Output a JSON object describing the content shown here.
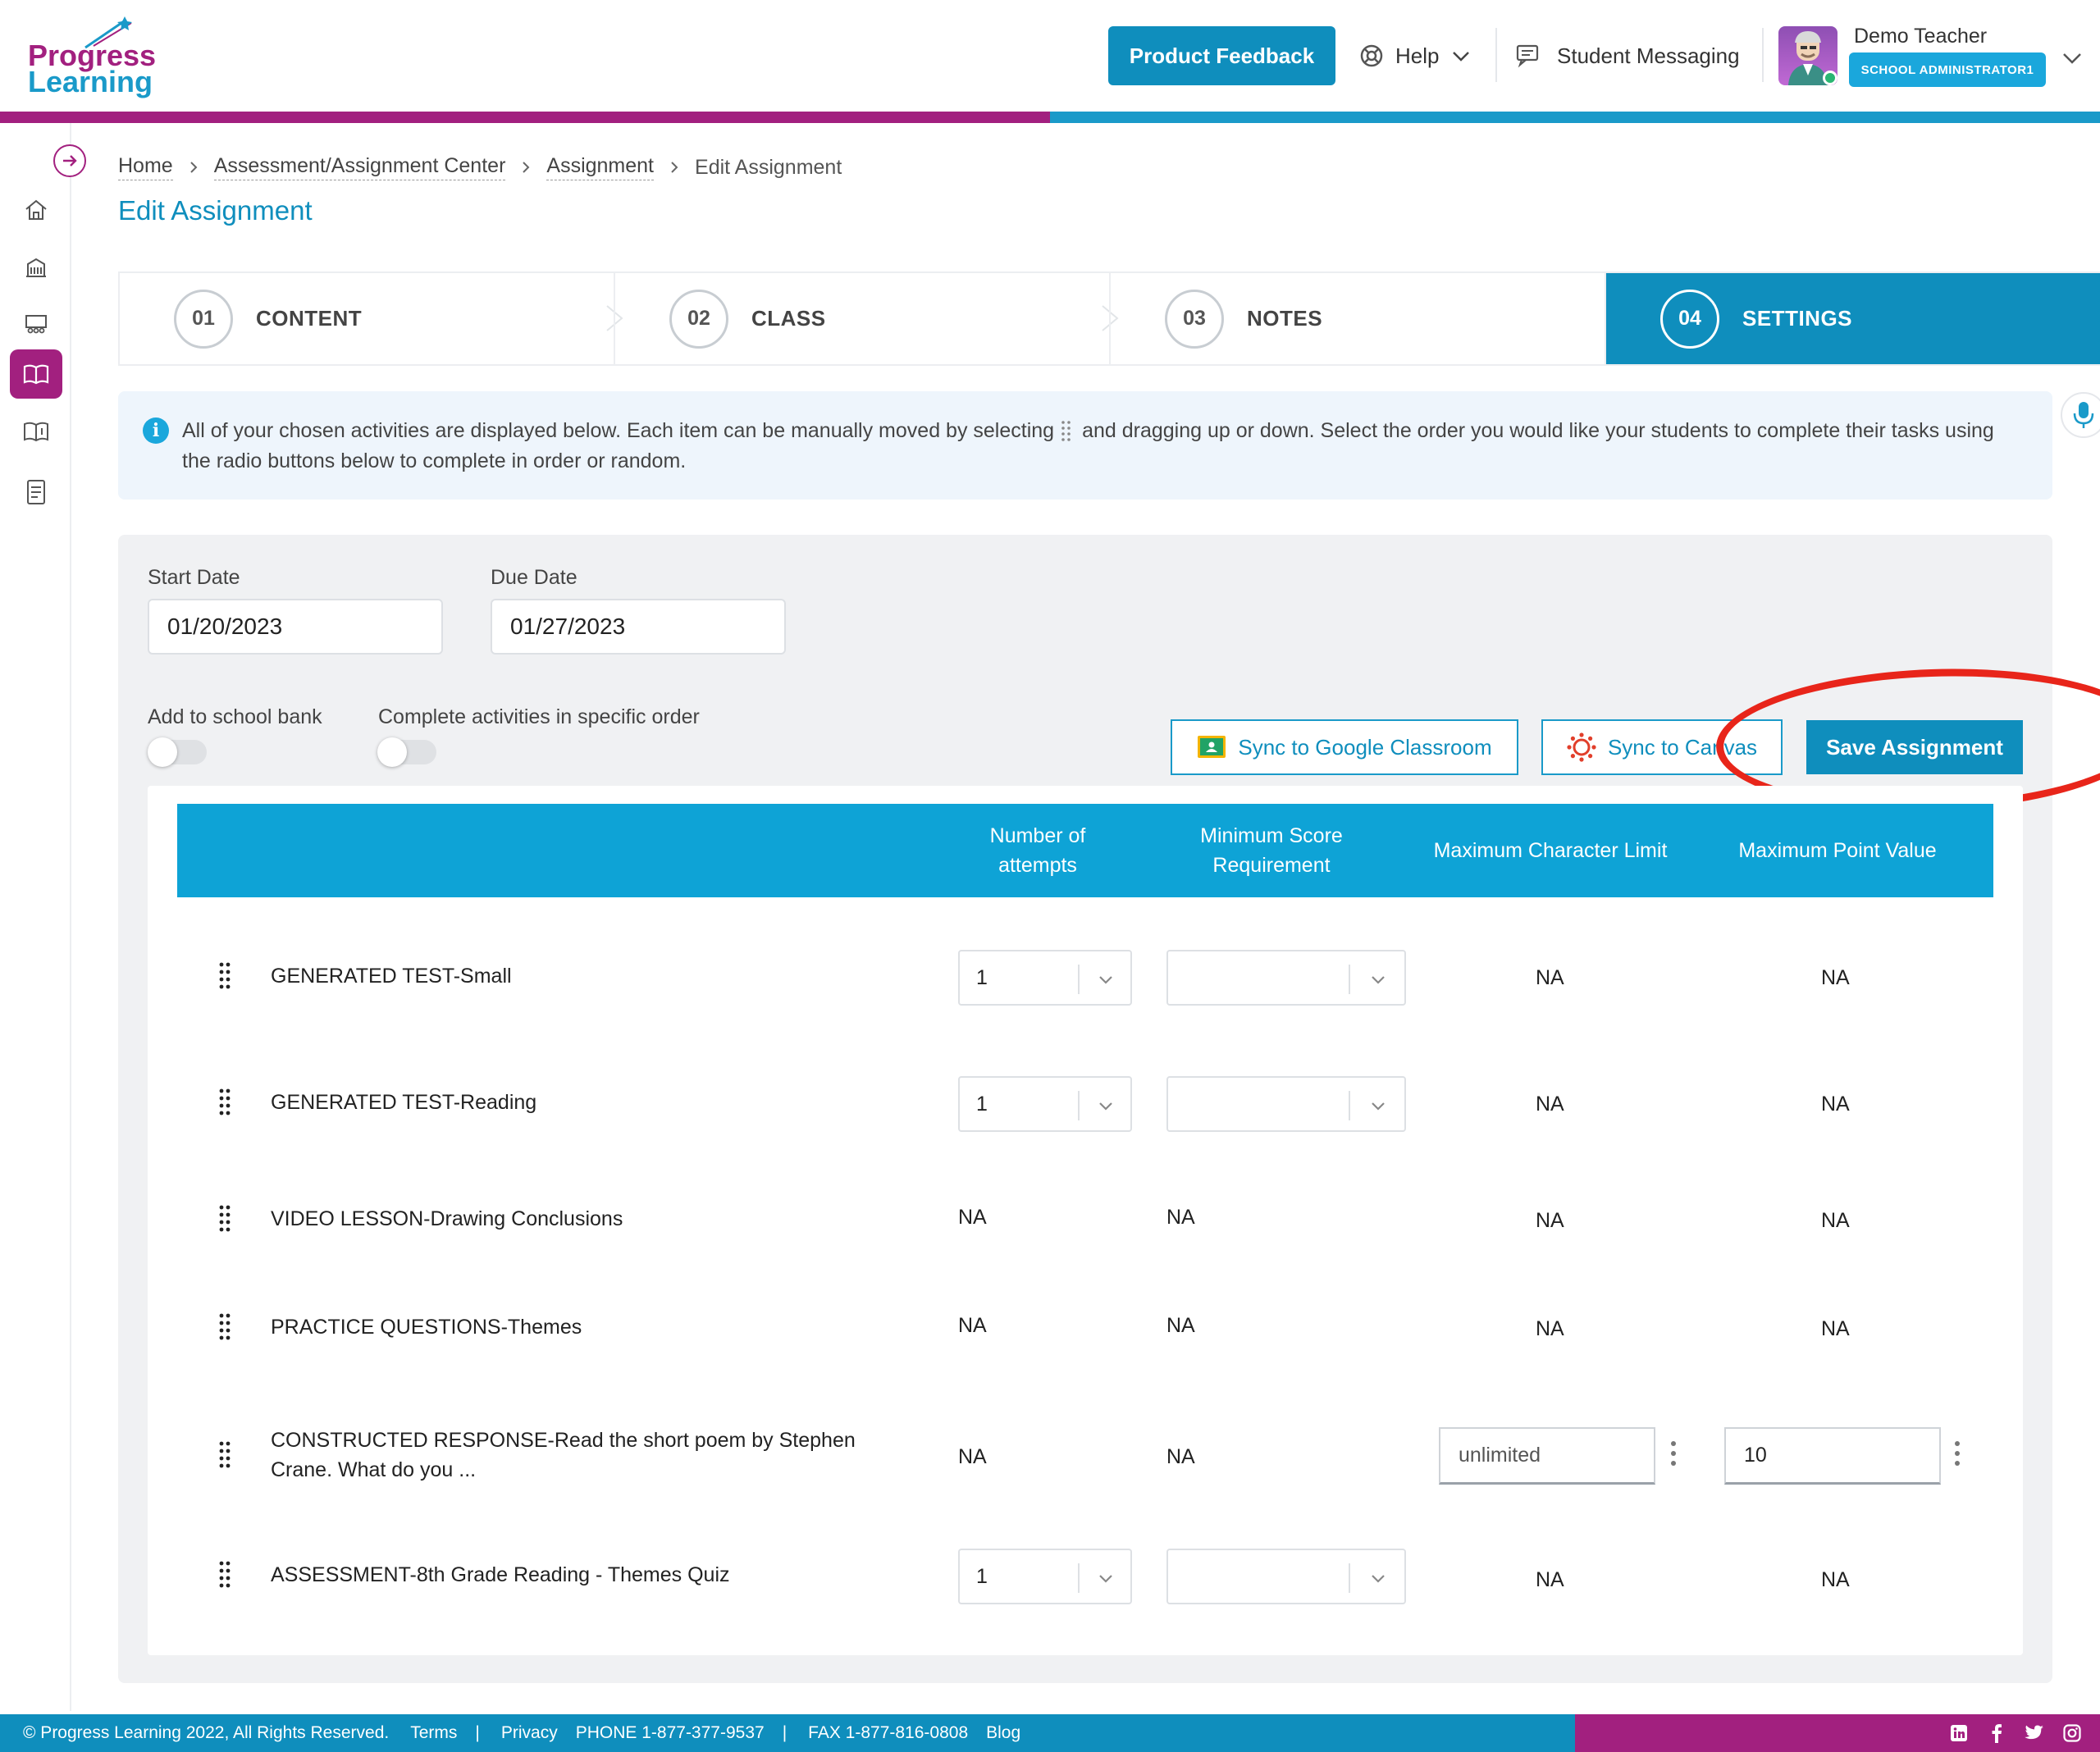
{
  "brand": {
    "line1": "Progress",
    "line2": "Learning"
  },
  "header": {
    "feedback_label": "Product Feedback",
    "help_label": "Help",
    "messaging_label": "Student Messaging",
    "user_name": "Demo Teacher",
    "user_role": "SCHOOL ADMINISTRATOR1"
  },
  "breadcrumb": {
    "home": "Home",
    "center": "Assessment/Assignment Center",
    "assignment": "Assignment",
    "current": "Edit Assignment"
  },
  "page_title": "Edit Assignment",
  "steps": [
    {
      "num": "01",
      "label": "CONTENT"
    },
    {
      "num": "02",
      "label": "CLASS"
    },
    {
      "num": "03",
      "label": "NOTES"
    },
    {
      "num": "04",
      "label": "SETTINGS"
    }
  ],
  "info": {
    "before": "All of your chosen activities are displayed below. Each item can be manually moved by selecting",
    "after": "and dragging up or down. Select the order you would like your students to complete their tasks using the radio buttons below to complete in order or random."
  },
  "settings": {
    "start_label": "Start Date",
    "start_value": "01/20/2023",
    "due_label": "Due Date",
    "due_value": "01/27/2023",
    "school_bank_label": "Add to school bank",
    "order_label": "Complete activities in specific order",
    "google_label": "Sync to Google Classroom",
    "canvas_label": "Sync to Canvas",
    "save_label": "Save Assignment"
  },
  "table": {
    "headers": {
      "attempts": "Number of attempts",
      "min_score": "Minimum Score Requirement",
      "max_char": "Maximum Character Limit",
      "max_point": "Maximum Point Value"
    },
    "rows": [
      {
        "title": "GENERATED TEST-Small",
        "attempts": "1",
        "min_score": "",
        "max_char": "NA",
        "max_point": "NA"
      },
      {
        "title": "GENERATED TEST-Reading",
        "attempts": "1",
        "min_score": "",
        "max_char": "NA",
        "max_point": "NA"
      },
      {
        "title": "VIDEO LESSON-Drawing Conclusions",
        "attempts": "NA",
        "min_score": "NA",
        "max_char": "NA",
        "max_point": "NA"
      },
      {
        "title": "PRACTICE QUESTIONS-Themes",
        "attempts": "NA",
        "min_score": "NA",
        "max_char": "NA",
        "max_point": "NA"
      },
      {
        "title": "CONSTRUCTED RESPONSE-Read the short poem by Stephen Crane. What do you ...",
        "attempts": "NA",
        "min_score": "NA",
        "max_char": "unlimited",
        "max_point": "10"
      },
      {
        "title": "ASSESSMENT-8th Grade Reading - Themes Quiz",
        "attempts": "1",
        "min_score": "",
        "max_char": "NA",
        "max_point": "NA"
      }
    ]
  },
  "footer": {
    "copyright": "© Progress Learning 2022, All Rights Reserved.",
    "terms": "Terms",
    "pipe": "|",
    "privacy": "Privacy",
    "phone": "PHONE 1-877-377-9537",
    "fax": "FAX 1-877-816-0808",
    "blog": "Blog"
  },
  "colors": {
    "brand_purple": "#a2207f",
    "brand_blue": "#0f8ebd",
    "annotation_red": "#e8251a"
  }
}
